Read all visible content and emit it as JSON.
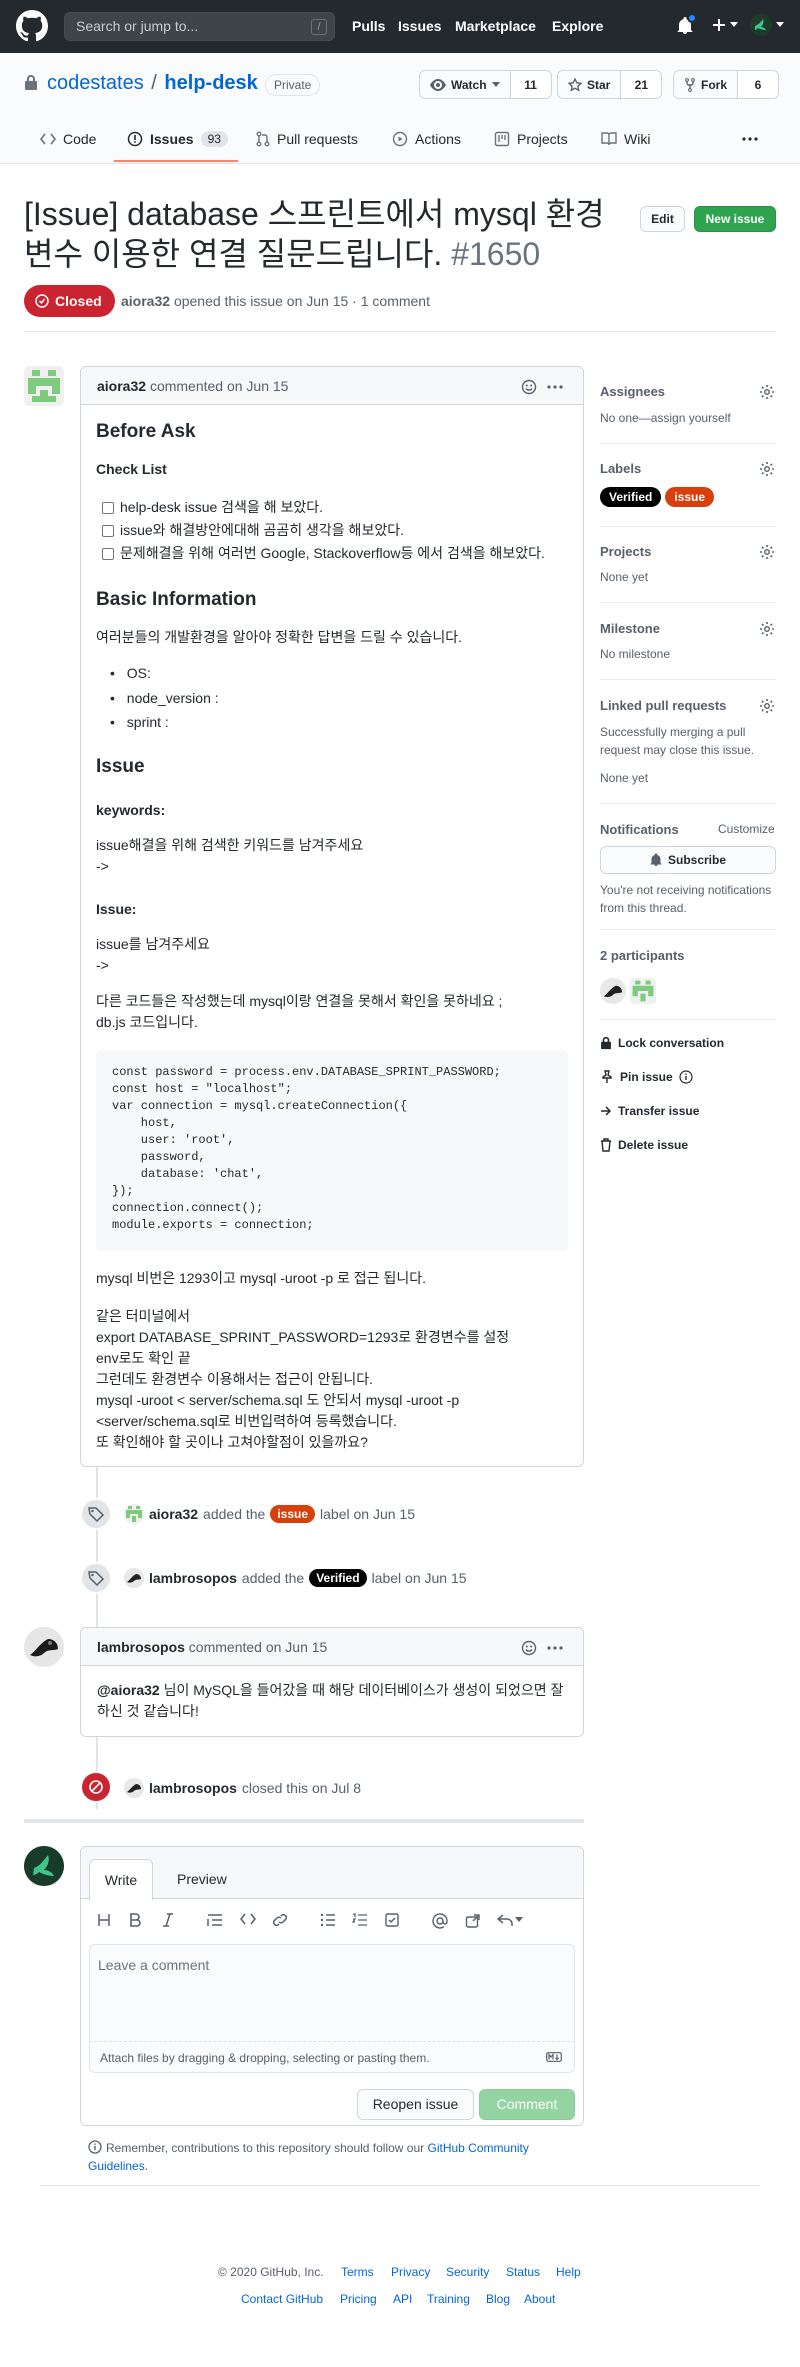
{
  "header": {
    "search_placeholder": "Search or jump to...",
    "search_shortcut": "/",
    "nav": [
      "Pulls",
      "Issues",
      "Marketplace",
      "Explore"
    ]
  },
  "repo": {
    "owner": "codestates",
    "separator": "/",
    "name": "help-desk",
    "visibility": "Private",
    "watch_label": "Watch",
    "watch_count": "11",
    "star_label": "Star",
    "star_count": "21",
    "fork_label": "Fork",
    "fork_count": "6",
    "tabs": [
      {
        "label": "Code"
      },
      {
        "label": "Issues",
        "count": "93"
      },
      {
        "label": "Pull requests"
      },
      {
        "label": "Actions"
      },
      {
        "label": "Projects"
      },
      {
        "label": "Wiki"
      }
    ]
  },
  "issue": {
    "title": "[Issue] database 스프린트에서 mysql 환경변수 이용한 연결 질문드립니다.",
    "number": "#1650",
    "edit_label": "Edit",
    "new_issue_label": "New issue",
    "state": "Closed",
    "author": "aiora32",
    "meta": "opened this issue on Jun 15 · 1 comment"
  },
  "comment1": {
    "author": "aiora32",
    "meta": "commented on Jun 15",
    "h_before_ask": "Before Ask",
    "h_checklist": "Check List",
    "checklist": [
      "help-desk issue 검색을 해 보았다.",
      "issue와 해결방안에대해 곰곰히 생각을 해보았다.",
      "문제해결을 위해 여러번 Google, Stackoverflow등 에서 검색을 해보았다."
    ],
    "h_basic_info": "Basic Information",
    "basic_info_text": "여러분들의 개발환경을 알아야 정확한 답변을 드릴 수 있습니다.",
    "env_items": [
      "OS:",
      "node_version :",
      "sprint :"
    ],
    "h_issue": "Issue",
    "keywords_label": "keywords:",
    "keywords_text": "issue해결을 위해 검색한 키워드를 남겨주세요",
    "arrow": "->",
    "issue_label": "Issue:",
    "issue_text": "issue를 남겨주세요",
    "desc_line1": "다른 코드들은 작성했는데 mysql이랑 연결을 못해서 확인을 못하네요 ;",
    "desc_line2": "db.js 코드입니다.",
    "code": [
      "const password = process.env.DATABASE_SPRINT_PASSWORD;",
      "const host = \"localhost\";",
      "var connection = mysql.createConnection({",
      "    host,",
      "    user: 'root',",
      "    password,",
      "    database: 'chat',",
      "});",
      "connection.connect();",
      "module.exports = connection;"
    ],
    "after_code": "mysql 비번은 1293이고 mysql -uroot -p 로 접근 됩니다.",
    "final_lines": [
      "같은 터미널에서",
      "export DATABASE_SPRINT_PASSWORD=1293로 환경변수를 설정",
      "env로도 확인 끝",
      "그런데도 환경변수 이용해서는 접근이 안됩니다.",
      "mysql -uroot < server/schema.sql 도 안되서 mysql -uroot -p",
      "<server/schema.sql로 비번입력하여 등록했습니다.",
      "또 확인해야 할 곳이나 고쳐야할점이 있을까요?"
    ]
  },
  "events": {
    "label1_user": "aiora32",
    "label1_pre": "added the",
    "label1_name": "issue",
    "label1_post": "label on Jun 15",
    "label2_user": "lambrosopos",
    "label2_pre": "added the",
    "label2_name": "Verified",
    "label2_post": "label on Jun 15",
    "closed_user": "lambrosopos",
    "closed_text": "closed this on Jul 8"
  },
  "comment2": {
    "author": "lambrosopos",
    "meta": "commented on Jun 15",
    "mention": "@aiora32",
    "text": " 님이 MySQL을 들어갔을 때 해당 데이터베이스가 생성이 되었으면 잘 하신 것 같습니다!"
  },
  "editor": {
    "tab_write": "Write",
    "tab_preview": "Preview",
    "placeholder": "Leave a comment",
    "attach_text": "Attach files by dragging & dropping, selecting or pasting them.",
    "reopen_label": "Reopen issue",
    "comment_label": "Comment",
    "note_text": "Remember, contributions to this repository should follow our",
    "note_link": "GitHub Community Guidelines",
    "note_end": "."
  },
  "sidebar": {
    "assignees_h": "Assignees",
    "assignees_v": "No one—assign yourself",
    "labels_h": "Labels",
    "labels": [
      {
        "name": "Verified",
        "color": "#000000"
      },
      {
        "name": "issue",
        "color": "#d93f0b"
      }
    ],
    "projects_h": "Projects",
    "projects_v": "None yet",
    "milestone_h": "Milestone",
    "milestone_v": "No milestone",
    "linked_h": "Linked pull requests",
    "linked_v": "Successfully merging a pull request may close this issue.",
    "linked_v2": "None yet",
    "notif_h": "Notifications",
    "notif_customize": "Customize",
    "subscribe_label": "Subscribe",
    "notif_text": "You're not receiving notifications from this thread.",
    "participants_h": "2 participants",
    "lock": "Lock conversation",
    "pin": "Pin issue",
    "transfer": "Transfer issue",
    "delete": "Delete issue"
  },
  "footer": {
    "copyright": "© 2020 GitHub, Inc.",
    "row1": [
      "Terms",
      "Privacy",
      "Security",
      "Status",
      "Help"
    ],
    "row2": [
      "Contact GitHub",
      "Pricing",
      "API",
      "Training",
      "Blog",
      "About"
    ]
  },
  "colors": {
    "closed": "#cb2431",
    "green": "#2ea44f",
    "link": "#0366d6"
  }
}
